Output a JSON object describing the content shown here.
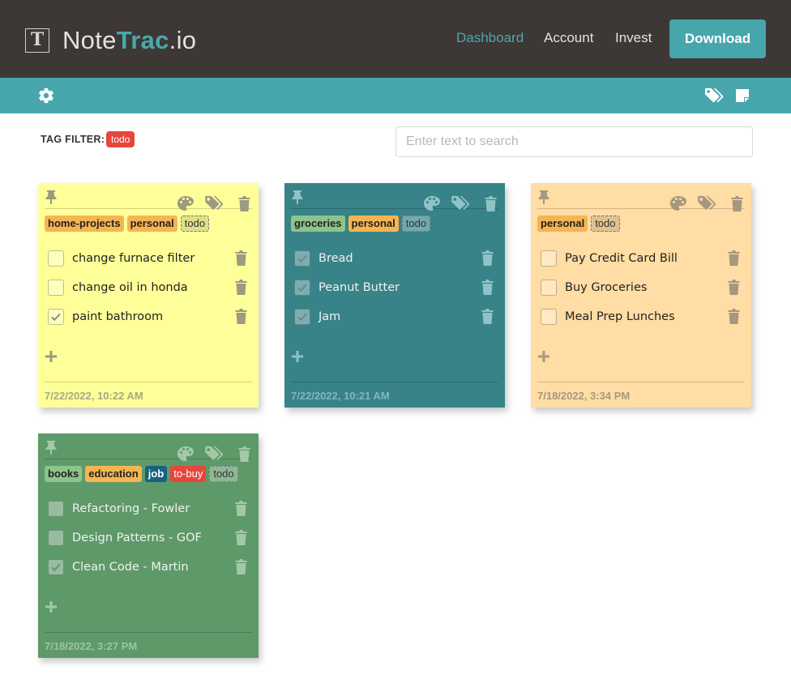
{
  "header": {
    "logo_letter": "T",
    "logo_light": "Note",
    "logo_bold": "Trac",
    "logo_suffix": ".io",
    "nav": [
      "Dashboard",
      "Account",
      "Invest"
    ],
    "download_label": "Download"
  },
  "filter": {
    "label": "TAG FILTER:",
    "active_tag": "todo",
    "search_placeholder": "Enter text to search"
  },
  "colors": {
    "header_bg": "#3d3735",
    "accent": "#46a6ab",
    "note_yellow": "#ffff99",
    "note_teal": "#378388",
    "note_peach": "#ffdda4",
    "note_green": "#5e9a69",
    "tag_orange": "#f6b552",
    "tag_green": "#8cc48c",
    "tag_blue": "#156382",
    "tag_red": "#e8453c"
  },
  "icons": [
    "gear-icon",
    "tags-icon",
    "sticky-note-icon",
    "pin-icon",
    "palette-icon",
    "trash-icon",
    "check-icon",
    "plus-icon"
  ],
  "notes": [
    {
      "tags": [
        "home-projects",
        "personal",
        "todo"
      ],
      "items": [
        {
          "text": "change furnace filter",
          "checked": false
        },
        {
          "text": "change oil in honda",
          "checked": false
        },
        {
          "text": "paint bathroom",
          "checked": true
        }
      ],
      "date": "7/22/2022, 10:22 AM"
    },
    {
      "tags": [
        "groceries",
        "personal",
        "todo"
      ],
      "items": [
        {
          "text": "Bread",
          "checked": true
        },
        {
          "text": "Peanut Butter",
          "checked": true
        },
        {
          "text": "Jam",
          "checked": true
        }
      ],
      "date": "7/22/2022, 10:21 AM"
    },
    {
      "tags": [
        "personal",
        "todo"
      ],
      "items": [
        {
          "text": "Pay Credit Card Bill",
          "checked": false
        },
        {
          "text": "Buy Groceries",
          "checked": false
        },
        {
          "text": "Meal Prep Lunches",
          "checked": false
        }
      ],
      "date": "7/18/2022, 3:34 PM"
    },
    {
      "tags": [
        "books",
        "education",
        "job",
        "to-buy",
        "todo"
      ],
      "items": [
        {
          "text": "Refactoring - Fowler",
          "checked": false
        },
        {
          "text": "Design Patterns - GOF",
          "checked": false
        },
        {
          "text": "Clean Code - Martin",
          "checked": true
        }
      ],
      "date": "7/18/2022, 3:27 PM"
    }
  ]
}
